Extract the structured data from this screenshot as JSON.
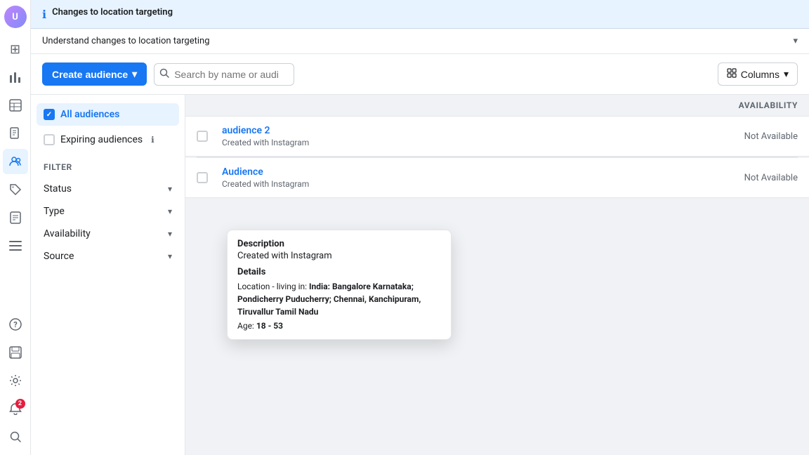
{
  "nav": {
    "avatar_initials": "U",
    "icons": [
      {
        "name": "grid-icon",
        "symbol": "⊞"
      },
      {
        "name": "chart-icon",
        "symbol": "📊"
      },
      {
        "name": "table-icon",
        "symbol": "⊟"
      },
      {
        "name": "list-icon",
        "symbol": "≡"
      },
      {
        "name": "audiences-icon",
        "symbol": "👥"
      },
      {
        "name": "tag-icon",
        "symbol": "🏷"
      },
      {
        "name": "report-icon",
        "symbol": "📋"
      }
    ],
    "bottom_icons": [
      {
        "name": "help-icon",
        "symbol": "?"
      },
      {
        "name": "save-icon",
        "symbol": "💾"
      },
      {
        "name": "settings-icon",
        "symbol": "⚙"
      },
      {
        "name": "bell-icon",
        "symbol": "🔔",
        "badge": "2"
      },
      {
        "name": "search-nav-icon",
        "symbol": "🔍"
      }
    ]
  },
  "banner": {
    "icon": "ℹ",
    "text": "Changes to location targeting"
  },
  "understand_bar": {
    "text": "Understand changes to location targeting",
    "chevron": "▼"
  },
  "toolbar": {
    "create_button": "Create audience",
    "create_chevron": "▾",
    "search_placeholder": "Search by name or audi",
    "columns_label": "Columns",
    "columns_icon": "⊞"
  },
  "sidebar": {
    "all_audiences_label": "All audiences",
    "expiring_audiences_label": "Expiring audiences",
    "expiring_info": "ℹ",
    "filter_title": "Filter",
    "filters": [
      {
        "label": "Status",
        "name": "status-filter"
      },
      {
        "label": "Type",
        "name": "type-filter"
      },
      {
        "label": "Availability",
        "name": "availability-filter"
      },
      {
        "label": "Source",
        "name": "source-filter"
      }
    ]
  },
  "table": {
    "header": {
      "availability_label": "Availability"
    },
    "rows": [
      {
        "name": "audience 2",
        "sub": "Created with Instagram",
        "availability": "Not Available"
      },
      {
        "name": "Audience",
        "sub": "Created with Instagram",
        "availability": "Not Available"
      }
    ]
  },
  "tooltip": {
    "description_label": "Description",
    "description_value": "Created with Instagram",
    "details_label": "Details",
    "location_prefix": "Location - living in:",
    "location_value": "India: Bangalore Karnataka; Pondicherry Puducherry; Chennai, Kanchipuram, Tiruvallur Tamil Nadu",
    "age_prefix": "Age:",
    "age_value": "18 - 53"
  }
}
